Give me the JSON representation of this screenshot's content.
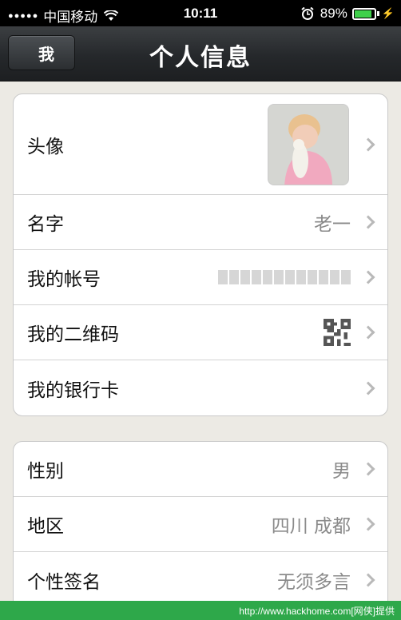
{
  "status_bar": {
    "carrier": "中国移动",
    "time": "10:11",
    "battery_percent": "89%",
    "battery_level": 0.89
  },
  "nav": {
    "back_label": "我",
    "title": "个人信息"
  },
  "group1": {
    "rows": [
      {
        "label": "头像",
        "value": ""
      },
      {
        "label": "名字",
        "value": "老一"
      },
      {
        "label": "我的帐号",
        "value": ""
      },
      {
        "label": "我的二维码",
        "value": ""
      },
      {
        "label": "我的银行卡",
        "value": ""
      }
    ]
  },
  "group2": {
    "rows": [
      {
        "label": "性别",
        "value": "男"
      },
      {
        "label": "地区",
        "value": "四川 成都"
      },
      {
        "label": "个性签名",
        "value": "无须多言"
      }
    ]
  },
  "watermark": {
    "text": "http://www.hackhome.com[网侠]提供"
  },
  "colors": {
    "nav_bg": "#25282b",
    "watermark_bg": "#2ea84a",
    "battery_fill": "#3fd04a"
  }
}
